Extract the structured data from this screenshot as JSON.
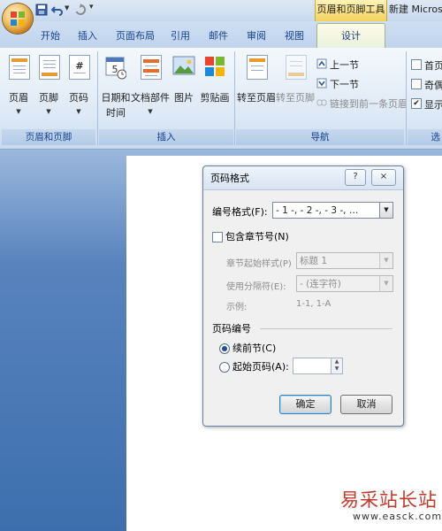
{
  "window": {
    "context_tab_title": "页眉和页脚工具",
    "doc_title": "新建 Micros"
  },
  "tabs": [
    {
      "label": "开始"
    },
    {
      "label": "插入"
    },
    {
      "label": "页面布局"
    },
    {
      "label": "引用"
    },
    {
      "label": "邮件"
    },
    {
      "label": "审阅"
    },
    {
      "label": "视图"
    },
    {
      "label": "设计"
    }
  ],
  "ribbon": {
    "header_footer_group": {
      "caption": "页眉和页脚",
      "buttons": [
        {
          "label": "页眉"
        },
        {
          "label": "页脚"
        },
        {
          "label": "页码"
        }
      ]
    },
    "insert_group": {
      "caption": "插入",
      "buttons": [
        {
          "label_line1": "日期和",
          "label_line2": "时间"
        },
        {
          "label": "文档部件"
        },
        {
          "label": "图片"
        },
        {
          "label": "剪贴画"
        }
      ]
    },
    "navigation_group": {
      "caption": "导航",
      "goto_header": "转至页眉",
      "goto_footer": "转至页脚",
      "prev_section": "上一节",
      "next_section": "下一节",
      "link_previous": "链接到前一条页眉"
    },
    "options_group": {
      "caption": "选",
      "items": [
        {
          "label": "首页",
          "checked": false
        },
        {
          "label": "奇偶",
          "checked": false
        },
        {
          "label": "显示",
          "checked": true
        }
      ]
    }
  },
  "dialog": {
    "title": "页码格式",
    "help_glyph": "?",
    "close_glyph": "×",
    "number_format_label": "编号格式(F):",
    "number_format_value": "- 1 -, - 2 -, - 3 -, …",
    "include_chapter_label": "包含章节号(N)",
    "include_chapter_checked": false,
    "chapter_style_label": "章节起始样式(P)",
    "chapter_style_value": "标题 1",
    "separator_label": "使用分隔符(E):",
    "separator_value": "-   (连字符)",
    "example_label": "示例:",
    "example_value": "1-1, 1-A",
    "page_numbering_label": "页码编号",
    "continue_label": "续前节(C)",
    "start_at_label": "起始页码(A):",
    "start_at_value": "",
    "selected_numbering": "continue",
    "ok_label": "确定",
    "cancel_label": "取消"
  },
  "watermark": {
    "site_name": "易采站长站",
    "url": "www.easck.com"
  }
}
